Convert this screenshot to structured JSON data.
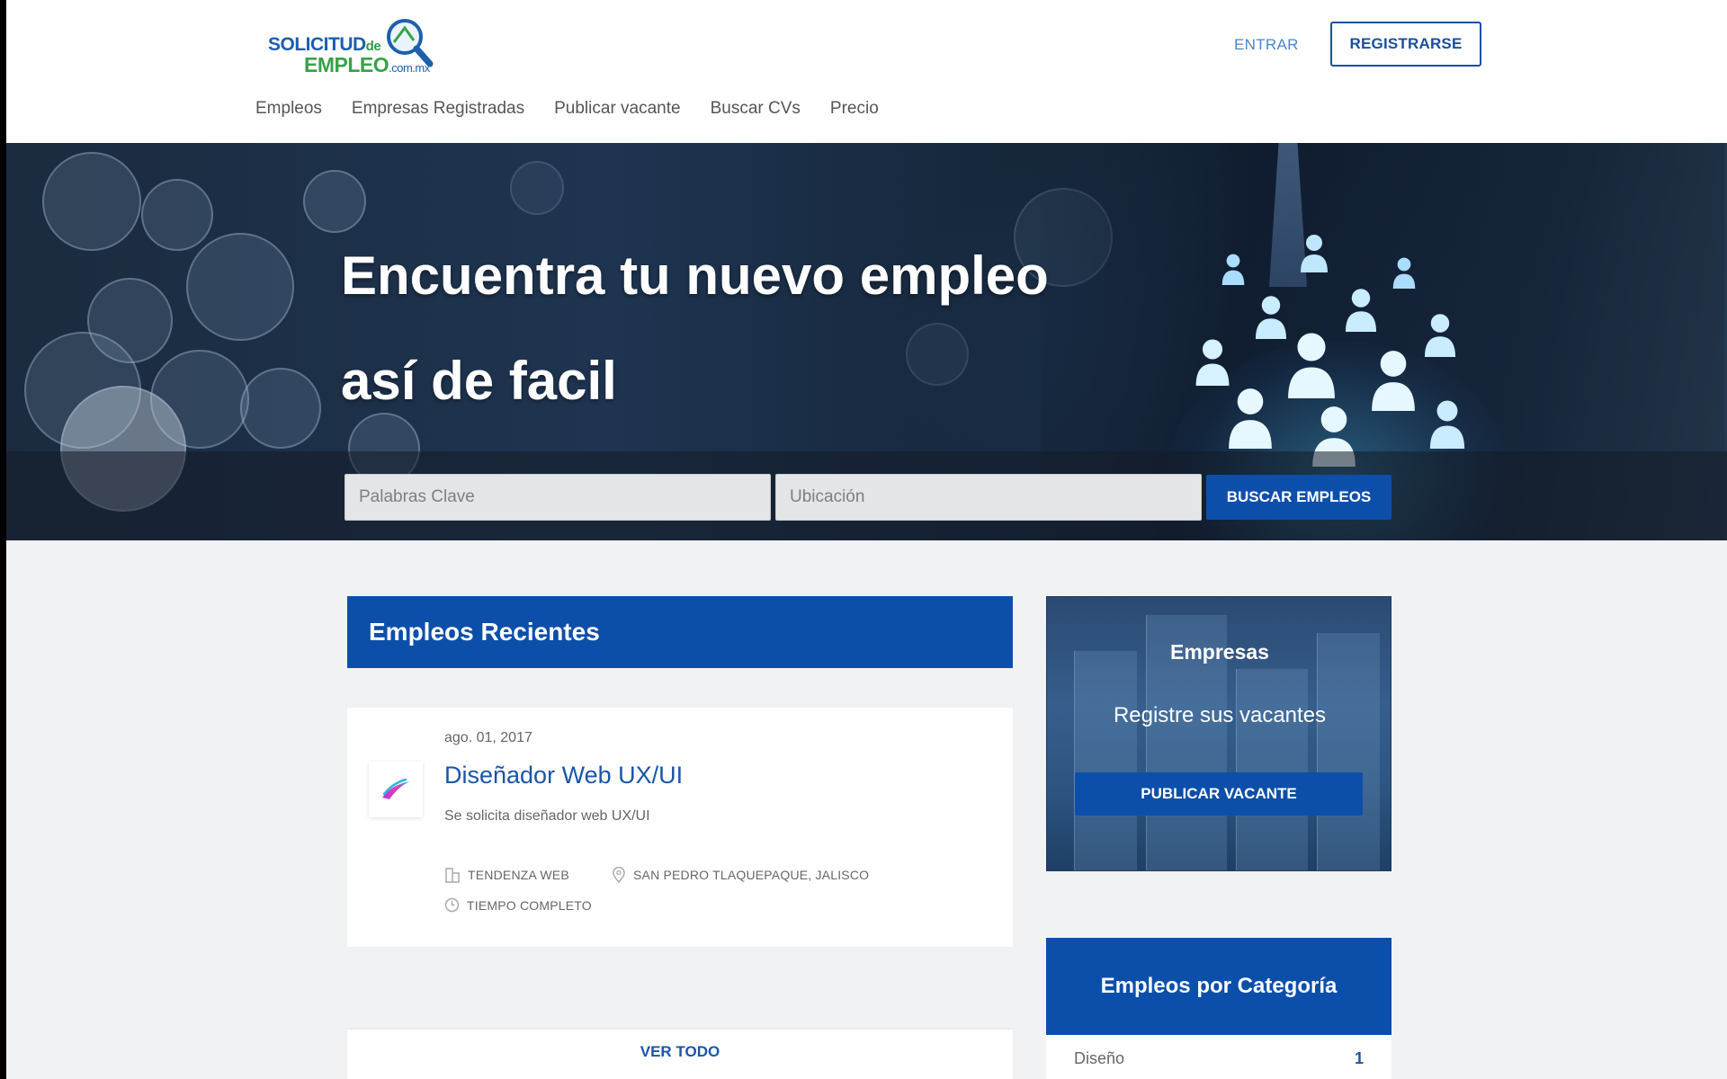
{
  "brand": {
    "logo_top": "SOLICITUD",
    "logo_top_small": "de",
    "logo_bottom": "EMPLEO",
    "logo_bottom_small": ".com.mx"
  },
  "header": {
    "login_label": "ENTRAR",
    "register_label": "REGISTRARSE"
  },
  "nav": {
    "items": [
      {
        "label": "Empleos"
      },
      {
        "label": "Empresas Registradas"
      },
      {
        "label": "Publicar vacante"
      },
      {
        "label": "Buscar CVs"
      },
      {
        "label": "Precio"
      }
    ]
  },
  "hero": {
    "title_line1": "Encuentra tu nuevo empleo",
    "title_line2": "así de facil",
    "keywords_placeholder": "Palabras Clave",
    "location_placeholder": "Ubicación",
    "search_label": "BUSCAR EMPLEOS"
  },
  "recent_jobs": {
    "title": "Empleos Recientes",
    "jobs": [
      {
        "date": "ago. 01, 2017",
        "title": "Diseñador Web UX/UI",
        "description": "Se solicita diseñador web UX/UI",
        "company": "TENDENZA WEB",
        "location": "SAN PEDRO TLAQUEPAQUE, JALISCO",
        "type": "TIEMPO COMPLETO"
      }
    ],
    "see_all_label": "VER TODO"
  },
  "companies": {
    "title": "Empresas",
    "subtitle": "Registre sus vacantes",
    "publish_label": "PUBLICAR VACANTE"
  },
  "categories": {
    "title": "Empleos por Categoría",
    "items": [
      {
        "name": "Diseño",
        "count": "1"
      }
    ]
  },
  "colors": {
    "primary": "#0c4faa",
    "link": "#1a55a8",
    "logo_blue": "#1d5fae",
    "logo_green": "#38a147",
    "background": "#f0f2f4"
  },
  "icons": {
    "company": "building-icon",
    "location": "map-pin-icon",
    "type": "clock-icon",
    "logo": "magnifier-icon"
  }
}
